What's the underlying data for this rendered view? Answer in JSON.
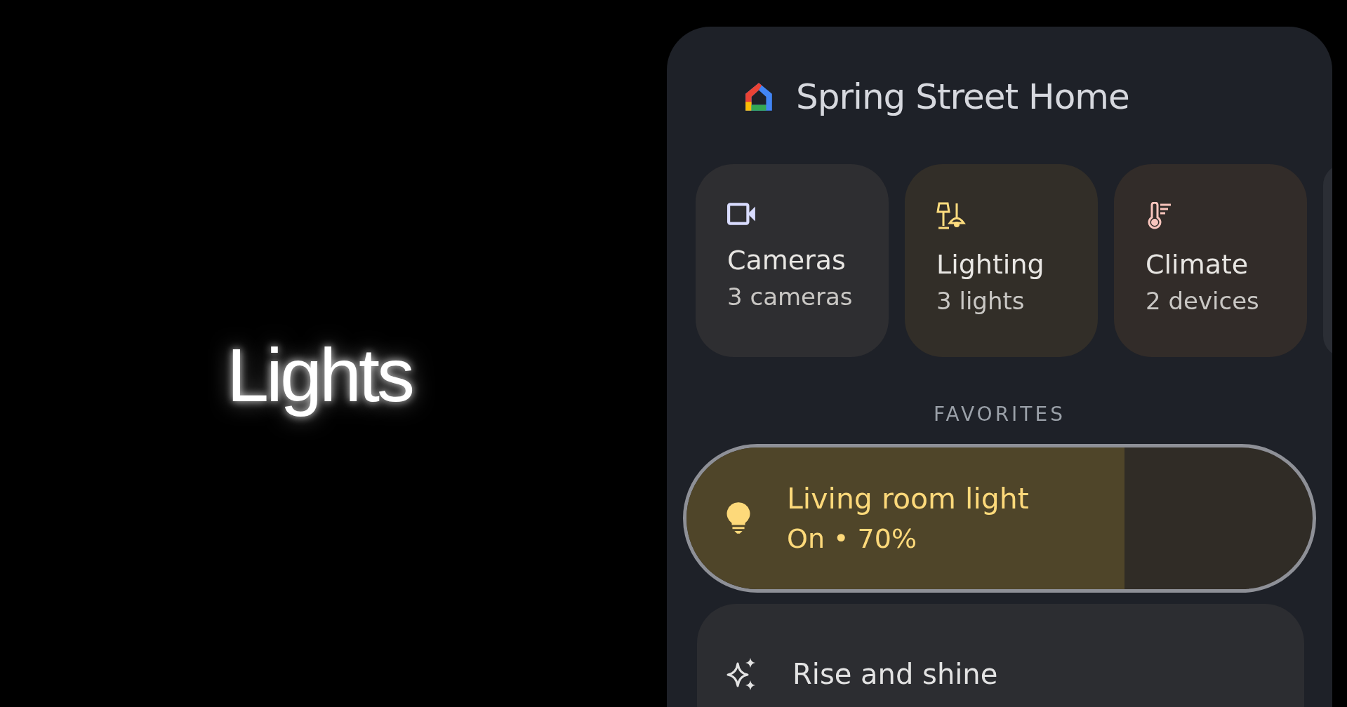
{
  "caption": "Lights",
  "home": {
    "title": "Spring Street Home"
  },
  "categories": [
    {
      "kind": "cameras",
      "label": "Cameras",
      "count": "3 cameras"
    },
    {
      "kind": "lighting",
      "label": "Lighting",
      "count": "3 lights"
    },
    {
      "kind": "climate",
      "label": "Climate",
      "count": "2 devices"
    }
  ],
  "section_title": "FAVORITES",
  "favorites": [
    {
      "name": "Living room light",
      "status": "On • 70%",
      "on": true,
      "level": 0.7
    }
  ],
  "scenes": [
    {
      "name": "Rise and shine"
    }
  ]
}
